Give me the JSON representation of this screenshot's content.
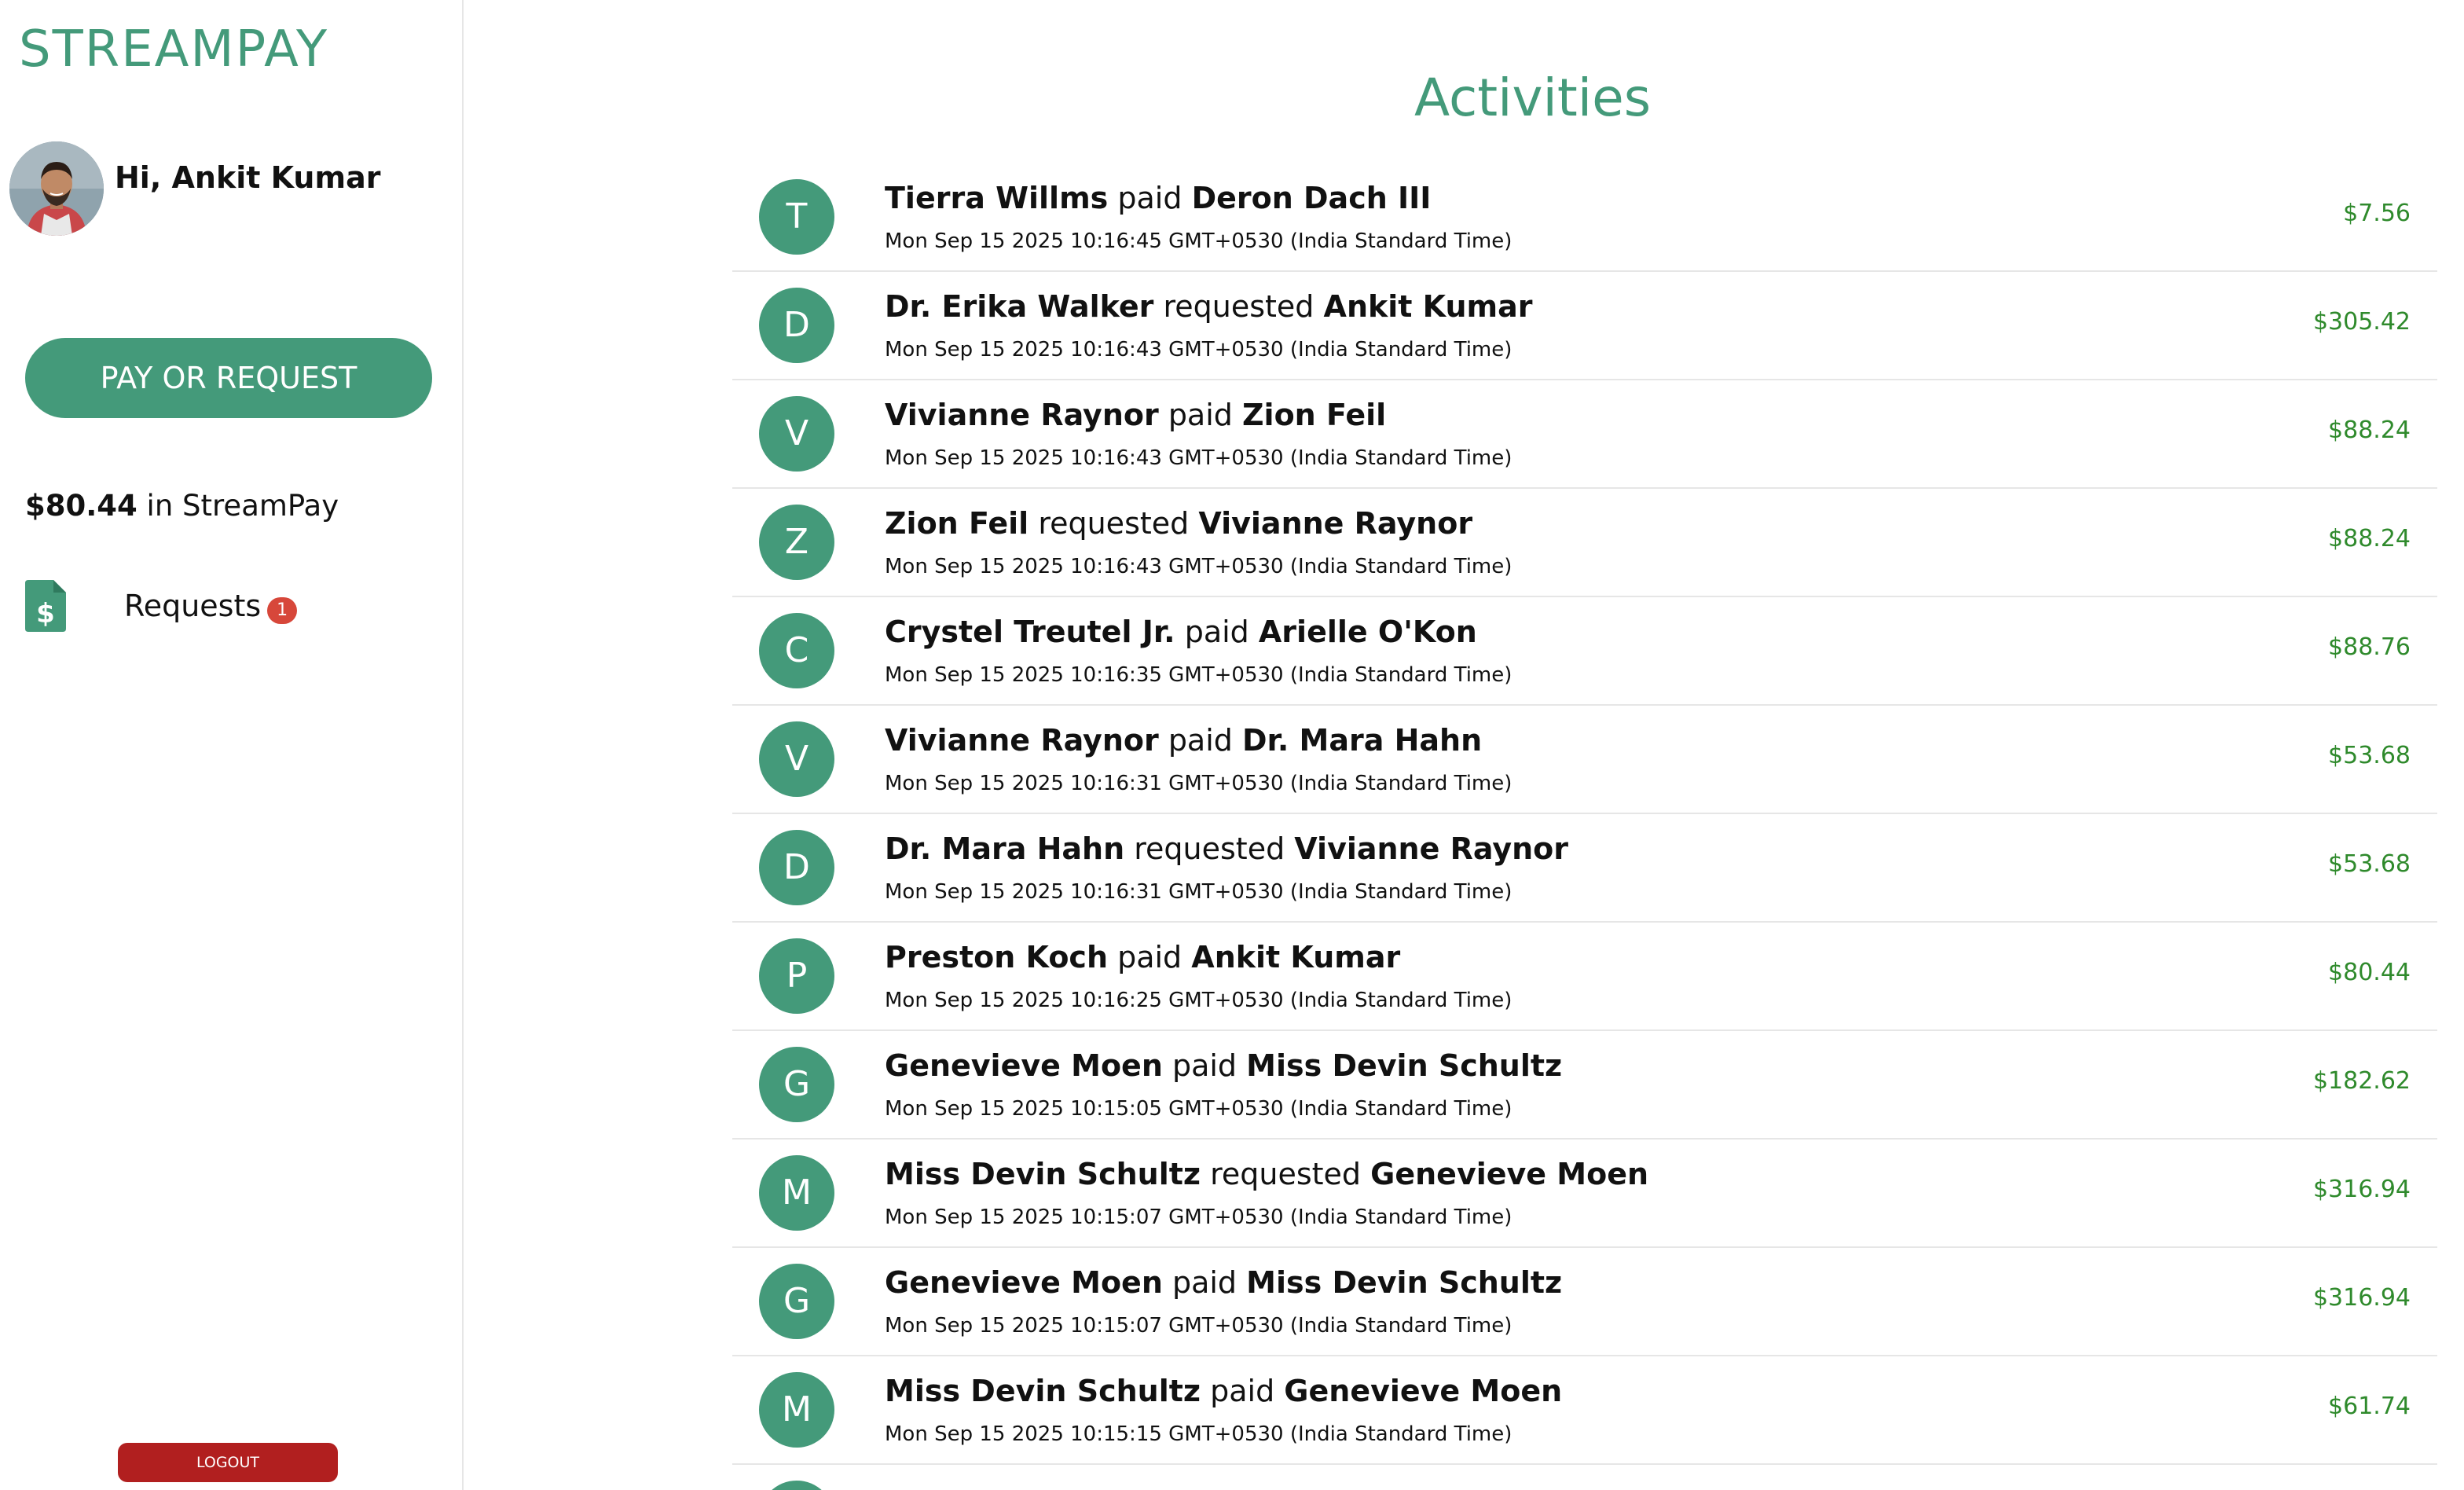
{
  "app": {
    "name": "STREAMPAY"
  },
  "sidebar": {
    "greeting": "Hi, Ankit Kumar",
    "pay_button": "PAY OR REQUEST",
    "balance_amount": "$80.44",
    "balance_suffix": " in StreamPay",
    "requests_label": "Requests",
    "requests_badge": "1",
    "logout_label": "LOGOUT"
  },
  "main": {
    "title": "Activities",
    "activities": [
      {
        "initial": "T",
        "from": "Tierra Willms",
        "action": "paid",
        "to": "Deron Dach III",
        "time": "Mon Sep 15 2025 10:16:45 GMT+0530 (India Standard Time)",
        "amount": "$7.56"
      },
      {
        "initial": "D",
        "from": "Dr. Erika Walker",
        "action": "requested",
        "to": "Ankit Kumar",
        "time": "Mon Sep 15 2025 10:16:43 GMT+0530 (India Standard Time)",
        "amount": "$305.42"
      },
      {
        "initial": "V",
        "from": "Vivianne Raynor",
        "action": "paid",
        "to": "Zion Feil",
        "time": "Mon Sep 15 2025 10:16:43 GMT+0530 (India Standard Time)",
        "amount": "$88.24"
      },
      {
        "initial": "Z",
        "from": "Zion Feil",
        "action": "requested",
        "to": "Vivianne Raynor",
        "time": "Mon Sep 15 2025 10:16:43 GMT+0530 (India Standard Time)",
        "amount": "$88.24"
      },
      {
        "initial": "C",
        "from": "Crystel Treutel Jr.",
        "action": "paid",
        "to": "Arielle O'Kon",
        "time": "Mon Sep 15 2025 10:16:35 GMT+0530 (India Standard Time)",
        "amount": "$88.76"
      },
      {
        "initial": "V",
        "from": "Vivianne Raynor",
        "action": "paid",
        "to": "Dr. Mara Hahn",
        "time": "Mon Sep 15 2025 10:16:31 GMT+0530 (India Standard Time)",
        "amount": "$53.68"
      },
      {
        "initial": "D",
        "from": "Dr. Mara Hahn",
        "action": "requested",
        "to": "Vivianne Raynor",
        "time": "Mon Sep 15 2025 10:16:31 GMT+0530 (India Standard Time)",
        "amount": "$53.68"
      },
      {
        "initial": "P",
        "from": "Preston Koch",
        "action": "paid",
        "to": "Ankit Kumar",
        "time": "Mon Sep 15 2025 10:16:25 GMT+0530 (India Standard Time)",
        "amount": "$80.44"
      },
      {
        "initial": "G",
        "from": "Genevieve Moen",
        "action": "paid",
        "to": "Miss Devin Schultz",
        "time": "Mon Sep 15 2025 10:15:05 GMT+0530 (India Standard Time)",
        "amount": "$182.62"
      },
      {
        "initial": "M",
        "from": "Miss Devin Schultz",
        "action": "requested",
        "to": "Genevieve Moen",
        "time": "Mon Sep 15 2025 10:15:07 GMT+0530 (India Standard Time)",
        "amount": "$316.94"
      },
      {
        "initial": "G",
        "from": "Genevieve Moen",
        "action": "paid",
        "to": "Miss Devin Schultz",
        "time": "Mon Sep 15 2025 10:15:07 GMT+0530 (India Standard Time)",
        "amount": "$316.94"
      },
      {
        "initial": "M",
        "from": "Miss Devin Schultz",
        "action": "paid",
        "to": "Genevieve Moen",
        "time": "Mon Sep 15 2025 10:15:15 GMT+0530 (India Standard Time)",
        "amount": "$61.74"
      }
    ]
  },
  "colors": {
    "brand": "#449a7a",
    "amount": "#2f8a2c",
    "badge": "#d7473a",
    "logout": "#b11f1f"
  },
  "icons": {
    "requests": "dollar-document-icon",
    "avatar": "user-photo"
  }
}
